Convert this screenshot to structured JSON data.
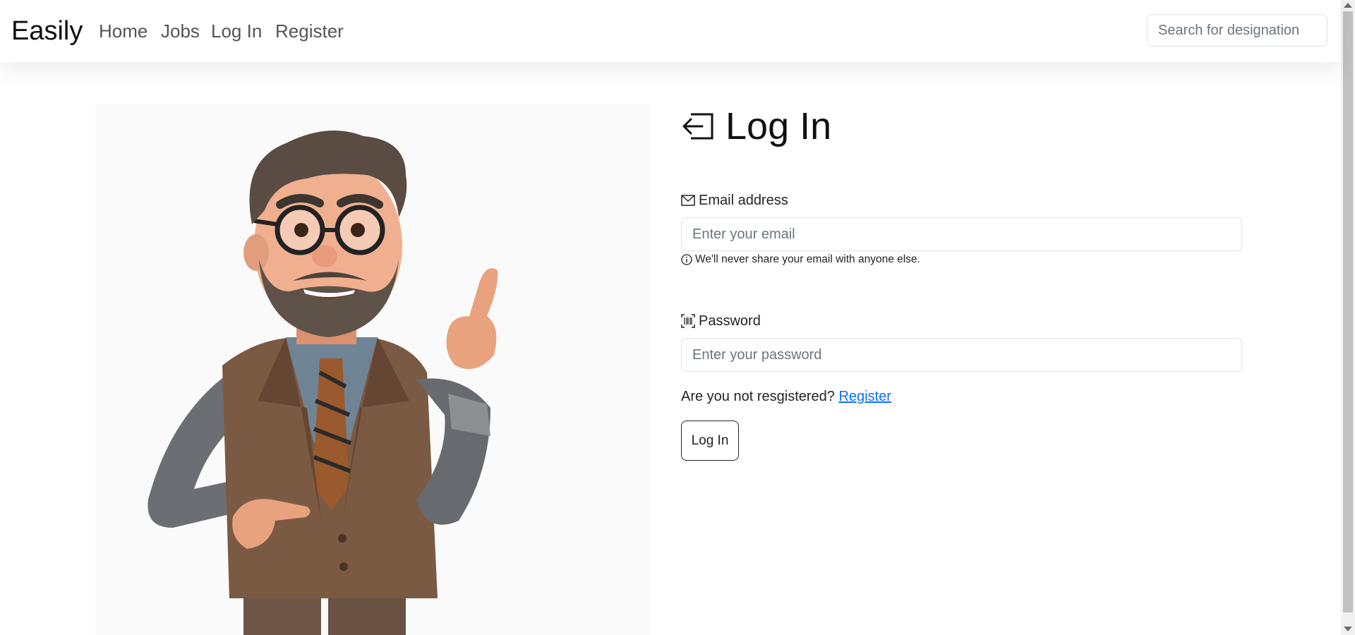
{
  "navbar": {
    "brand": "Easily",
    "links": [
      "Home",
      "Jobs",
      "Log In",
      "Register"
    ],
    "search_placeholder": "Search for designation"
  },
  "login": {
    "title": "Log In",
    "email_label": "Email address",
    "email_placeholder": "Enter your email",
    "email_help": "We'll never share your email with anyone else.",
    "password_label": "Password",
    "password_placeholder": "Enter your password",
    "register_prompt": "Are you not resgistered?",
    "register_link": "Register",
    "submit_label": "Log In"
  },
  "icons": {
    "login": "box-arrow-in-left-icon",
    "email": "envelope-icon",
    "info": "info-circle-icon",
    "password": "upc-scan-icon"
  },
  "colors": {
    "link": "#0d6efd",
    "text": "#212529",
    "border": "#dee2e6"
  }
}
